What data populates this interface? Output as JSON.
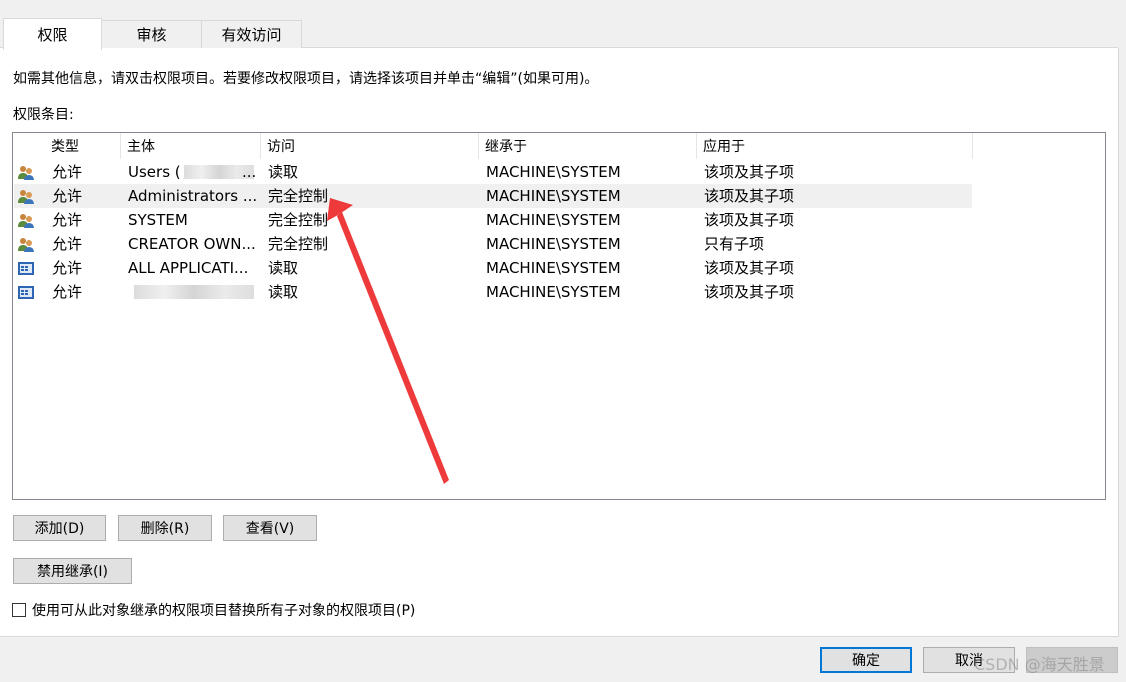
{
  "tabs": [
    {
      "label": "权限",
      "active": true
    },
    {
      "label": "审核",
      "active": false
    },
    {
      "label": "有效访问",
      "active": false
    }
  ],
  "info_text": "如需其他信息，请双击权限项目。若要修改权限项目，请选择该项目并单击“编辑”(如果可用)。",
  "entries_label": "权限条目:",
  "columns": [
    "类型",
    "主体",
    "访问",
    "继承于",
    "应用于"
  ],
  "rows": [
    {
      "icon": "users-group-icon",
      "type": "允许",
      "principal": "Users (",
      "principal_suffix": "...",
      "principal_redacted": true,
      "access": "读取",
      "inherited": "MACHINE\\SYSTEM",
      "applies": "该项及其子项",
      "selected": false
    },
    {
      "icon": "users-group-icon",
      "type": "允许",
      "principal": "Administrators ...",
      "principal_suffix": "",
      "principal_redacted": false,
      "access": "完全控制",
      "inherited": "MACHINE\\SYSTEM",
      "applies": "该项及其子项",
      "selected": true
    },
    {
      "icon": "users-group-icon",
      "type": "允许",
      "principal": "SYSTEM",
      "principal_suffix": "",
      "principal_redacted": false,
      "access": "完全控制",
      "inherited": "MACHINE\\SYSTEM",
      "applies": "该项及其子项",
      "selected": false
    },
    {
      "icon": "users-group-icon",
      "type": "允许",
      "principal": "CREATOR OWN...",
      "principal_suffix": "",
      "principal_redacted": false,
      "access": "完全控制",
      "inherited": "MACHINE\\SYSTEM",
      "applies": "只有子项",
      "selected": false
    },
    {
      "icon": "app-package-icon",
      "type": "允许",
      "principal": "ALL APPLICATI...",
      "principal_suffix": "",
      "principal_redacted": false,
      "access": "读取",
      "inherited": "MACHINE\\SYSTEM",
      "applies": "该项及其子项",
      "selected": false
    },
    {
      "icon": "app-package-icon",
      "type": "允许",
      "principal": "",
      "principal_suffix": "",
      "principal_redacted": true,
      "access": "读取",
      "inherited": "MACHINE\\SYSTEM",
      "applies": "该项及其子项",
      "selected": false
    }
  ],
  "buttons": {
    "add": "添加(D)",
    "remove": "删除(R)",
    "view": "查看(V)",
    "disable_inheritance": "禁用继承(I)",
    "ok": "确定",
    "cancel": "取消"
  },
  "replace_checkbox": {
    "label": "使用可从此对象继承的权限项目替换所有子对象的权限项目(P)",
    "checked": false
  },
  "watermark": "CSDN @海天胜景",
  "colors": {
    "annotation_arrow": "#ee3a3a",
    "selected_row": "#f0f0f0",
    "default_button_border": "#0078d7"
  }
}
